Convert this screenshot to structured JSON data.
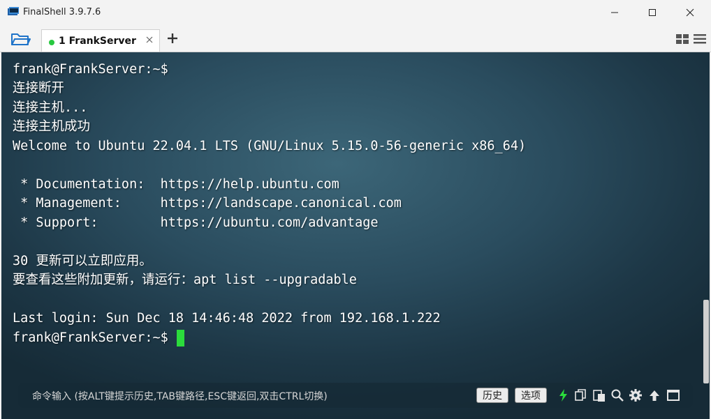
{
  "window": {
    "title": "FinalShell 3.9.7.6"
  },
  "tabs": [
    {
      "label": "1  FrankServer",
      "status": "connected",
      "status_color": "#28c840"
    }
  ],
  "terminal": {
    "lines": [
      "frank@FrankServer:~$",
      "连接断开",
      "连接主机...",
      "连接主机成功",
      "Welcome to Ubuntu 22.04.1 LTS (GNU/Linux 5.15.0-56-generic x86_64)",
      "",
      " * Documentation:  https://help.ubuntu.com",
      " * Management:     https://landscape.canonical.com",
      " * Support:        https://ubuntu.com/advantage",
      "",
      "30 更新可以立即应用。",
      "要查看这些附加更新，请运行：apt list --upgradable",
      "",
      "Last login: Sun Dec 18 14:46:48 2022 from 192.168.1.222",
      "frank@FrankServer:~$ "
    ],
    "cursor_color": "#2bdc3c"
  },
  "command_bar": {
    "placeholder": "命令输入 (按ALT键提示历史,TAB键路径,ESC键返回,双击CTRL切换)",
    "history_label": "历史",
    "options_label": "选项"
  },
  "icons": {
    "toolbar": [
      "lightning-icon",
      "copy-icon",
      "paste-icon",
      "search-icon",
      "gear-icon",
      "arrow-up-icon",
      "window-icon"
    ]
  },
  "colors": {
    "accent_green": "#2bdc3c",
    "status_green": "#28c840"
  }
}
